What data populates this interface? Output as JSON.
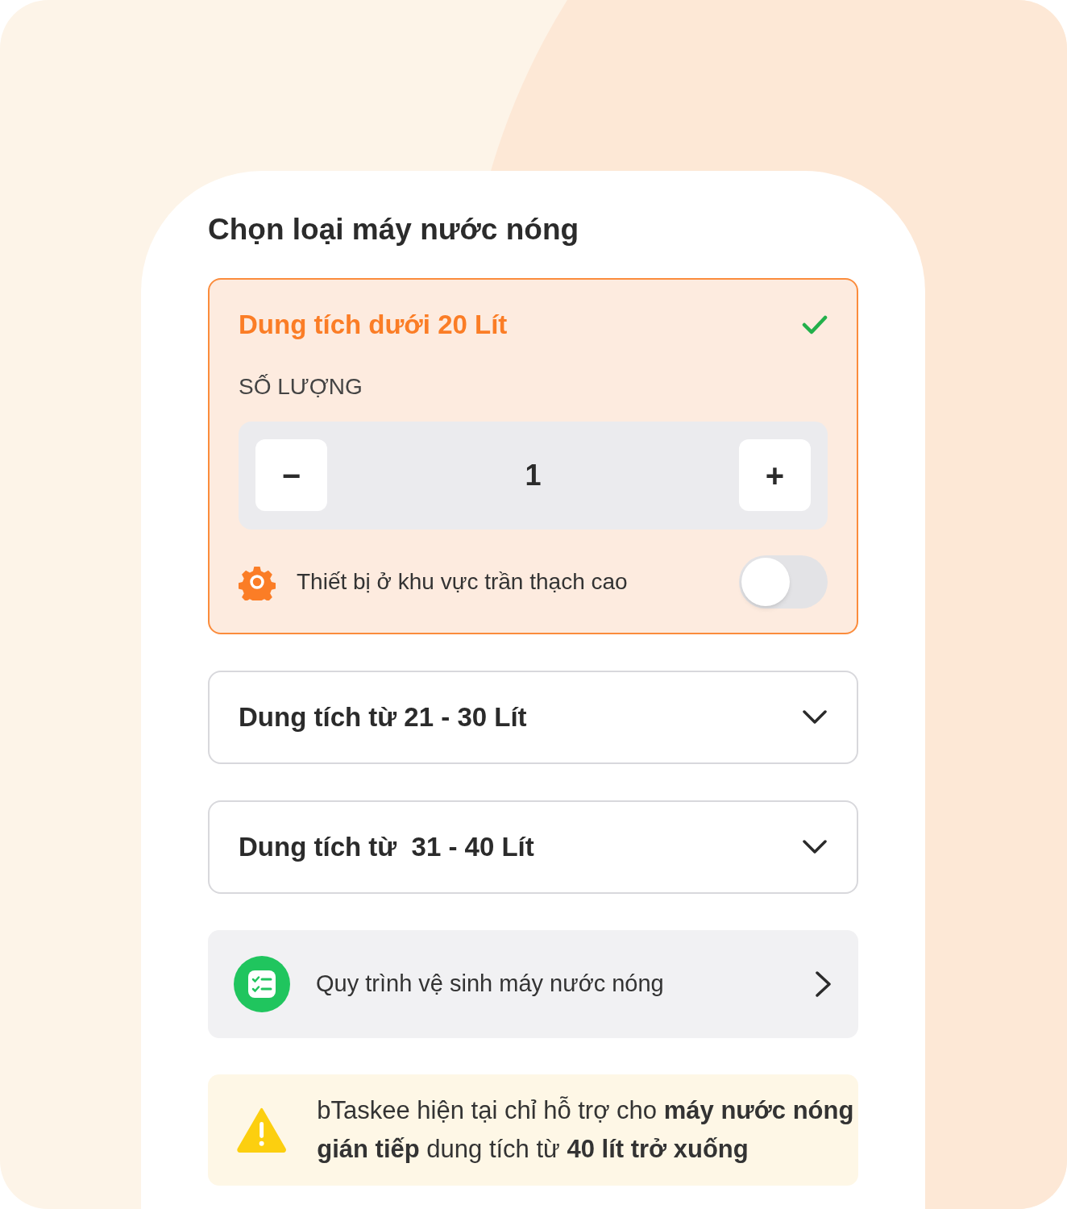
{
  "title": "Chọn loại máy nước nóng",
  "options": [
    {
      "label": "Dung tích dưới 20 Lít",
      "selected": true,
      "expanded": true,
      "quantity_label": "SỐ LƯỢNG",
      "minus": "−",
      "quantity": "1",
      "plus": "+",
      "setting": {
        "label": "Thiết bị ở khu vực trần thạch cao",
        "on": false
      }
    },
    {
      "label": "Dung tích từ 21 - 30 Lít",
      "selected": false,
      "expanded": false
    },
    {
      "label": "Dung tích từ  31 - 40 Lít",
      "selected": false,
      "expanded": false
    }
  ],
  "guide_link": {
    "label": "Quy trình vệ sinh máy nước nóng"
  },
  "notice": "bTaskee hiện tại chỉ hỗ trợ cho **máy nước nóng gián tiếp** dung tích từ **40 lít trở xuống**"
}
